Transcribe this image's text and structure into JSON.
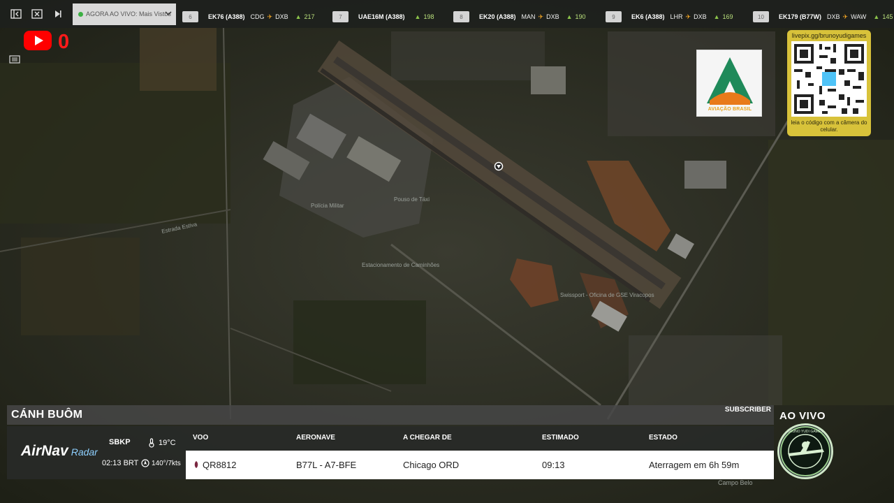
{
  "topbar": {
    "live_select": "AGORA AO VIVO: Mais Vistos",
    "flights": [
      {
        "rank": "6",
        "code": "EK76 (A388)",
        "from": "CDG",
        "to": "DXB",
        "views": "217"
      },
      {
        "rank": "7",
        "code": "UAE16M (A388)",
        "from": "",
        "to": "",
        "views": "198"
      },
      {
        "rank": "8",
        "code": "EK20 (A388)",
        "from": "MAN",
        "to": "DXB",
        "views": "190"
      },
      {
        "rank": "9",
        "code": "EK6 (A388)",
        "from": "LHR",
        "to": "DXB",
        "views": "169"
      },
      {
        "rank": "10",
        "code": "EK179 (B77W)",
        "from": "DXB",
        "to": "WAW",
        "views": "145"
      }
    ]
  },
  "youtube": {
    "count": "0"
  },
  "logo_a": {
    "text": "AVIAÇÃO BRASIL"
  },
  "qr": {
    "url": "livepix.gg/brunoyudigames",
    "caption": "leia o código com a câmera do celular."
  },
  "map": {
    "labels": [
      "Polícia Militar",
      "Pouso de Táxi",
      "Estacionamento de Caminhões",
      "Swissport - Oficina de GSE Viracopos",
      "Estrada Estiva",
      "Campo Belo"
    ]
  },
  "bottom": {
    "title": "CÁNH BUÔM",
    "subscriber": "SUBSCRIBER",
    "brand_main": "AirNav",
    "brand_sub": "Radar",
    "airport": "SBKP",
    "local_time": "02:13 BRT",
    "temperature": "19°C",
    "wind": "140°/7kts",
    "headers": {
      "flight": "VOO",
      "aircraft": "AERONAVE",
      "from": "A CHEGAR DE",
      "estimated": "ESTIMADO",
      "status": "ESTADO"
    },
    "row": {
      "flight": "QR8812",
      "aircraft": "B77L - A7-BFE",
      "from": "Chicago ORD",
      "estimated": "09:13",
      "status": "Aterragem em 6h 59m"
    }
  },
  "live_label": "AO VIVO",
  "badge_text": "BRUNO YUDI GAMES",
  "colors": {
    "accent_green": "#3cb043",
    "youtube_red": "#ff0000",
    "qr_bg": "#d8c23a",
    "views_green": "#8bc34a"
  }
}
